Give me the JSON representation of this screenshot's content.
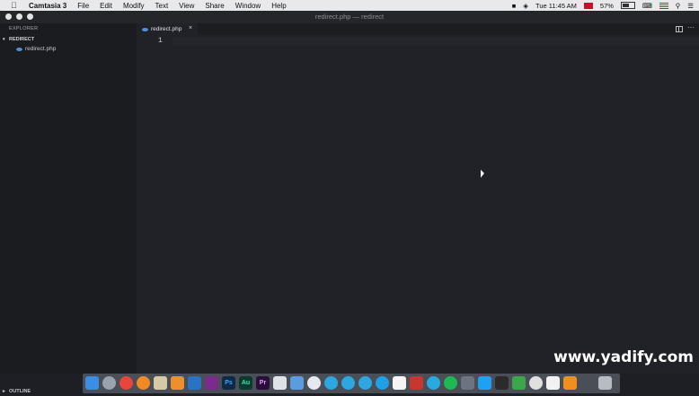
{
  "menubar": {
    "app_name": "Camtasia 3",
    "items": [
      "File",
      "Edit",
      "Modify",
      "Text",
      "View",
      "Share",
      "Window",
      "Help"
    ],
    "clock": "Tue 11:45 AM",
    "battery": "57%"
  },
  "window": {
    "title": "redirect.php — redirect"
  },
  "sidebar": {
    "section_title": "EXPLORER",
    "folder": "REDIRECT",
    "files": [
      "redirect.php"
    ],
    "outline": "OUTLINE"
  },
  "editor": {
    "tab_label": "redirect.php",
    "tab_close": "×",
    "line_numbers": [
      "1"
    ]
  },
  "dock": {
    "icons": [
      "finder-icon",
      "launchpad-icon",
      "chrome-icon",
      "firefox-icon",
      "notes-icon",
      "sublime-icon",
      "vscode-icon",
      "dreamweaver-icon",
      "photoshop-icon",
      "audition-icon",
      "premiere-icon",
      "paw-icon",
      "preview-icon",
      "itunes-icon",
      "telegram-icon",
      "telegram-alt-icon",
      "telegram-3-icon",
      "skype-icon",
      "calendar-icon",
      "filezilla-icon",
      "edge-icon",
      "spotify-icon",
      "steam-icon",
      "twitter-icon",
      "terminal-icon",
      "camtasia-icon",
      "wifi-icon",
      "textedit-icon",
      "vlc-icon",
      "trash-icon"
    ]
  },
  "dock_labels": {
    "photoshop": "Ps",
    "audition": "Au",
    "premiere": "Pr"
  },
  "watermark": "www.yadify.com"
}
